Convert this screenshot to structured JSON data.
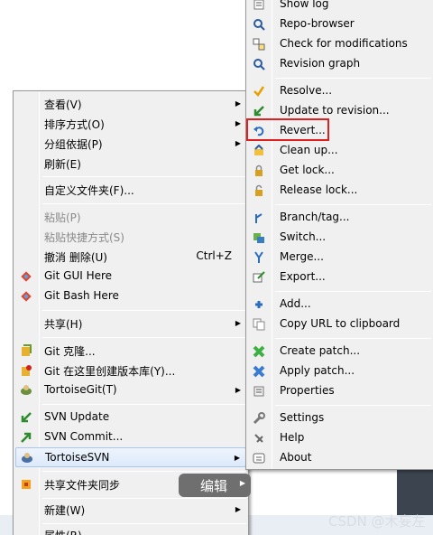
{
  "left_menu": {
    "items": [
      {
        "label": "查看(V)"
      },
      {
        "label": "排序方式(O)"
      },
      {
        "label": "分组依据(P)"
      },
      {
        "label": "刷新(E)"
      },
      {
        "label": "自定义文件夹(F)..."
      },
      {
        "label": "粘贴(P)"
      },
      {
        "label": "粘贴快捷方式(S)"
      },
      {
        "label": "撤消 删除(U)",
        "shortcut": "Ctrl+Z"
      },
      {
        "label": "Git GUI Here"
      },
      {
        "label": "Git Bash Here"
      },
      {
        "label": "共享(H)"
      },
      {
        "label": "Git 克隆..."
      },
      {
        "label": "Git 在这里创建版本库(Y)..."
      },
      {
        "label": "TortoiseGit(T)"
      },
      {
        "label": "SVN Update"
      },
      {
        "label": "SVN Commit..."
      },
      {
        "label": "TortoiseSVN"
      },
      {
        "label": "共享文件夹同步"
      },
      {
        "label": "新建(W)"
      },
      {
        "label": "属性(R)"
      }
    ]
  },
  "right_menu": {
    "items": [
      {
        "label": "Show log"
      },
      {
        "label": "Repo-browser"
      },
      {
        "label": "Check for modifications"
      },
      {
        "label": "Revision graph"
      },
      {
        "label": "Resolve..."
      },
      {
        "label": "Update to revision..."
      },
      {
        "label": "Revert..."
      },
      {
        "label": "Clean up..."
      },
      {
        "label": "Get lock..."
      },
      {
        "label": "Release lock..."
      },
      {
        "label": "Branch/tag..."
      },
      {
        "label": "Switch..."
      },
      {
        "label": "Merge..."
      },
      {
        "label": "Export..."
      },
      {
        "label": "Add..."
      },
      {
        "label": "Copy URL to clipboard"
      },
      {
        "label": "Create patch..."
      },
      {
        "label": "Apply patch..."
      },
      {
        "label": "Properties"
      },
      {
        "label": "Settings"
      },
      {
        "label": "Help"
      },
      {
        "label": "About"
      }
    ]
  },
  "tooltip": {
    "label": "编辑"
  },
  "watermark": {
    "text": "CSDN @木妄左"
  },
  "colors": {
    "highlight_border": "#e02020",
    "menu_bg": "#f0f0f0",
    "selected_bg": "#dce9fa"
  }
}
